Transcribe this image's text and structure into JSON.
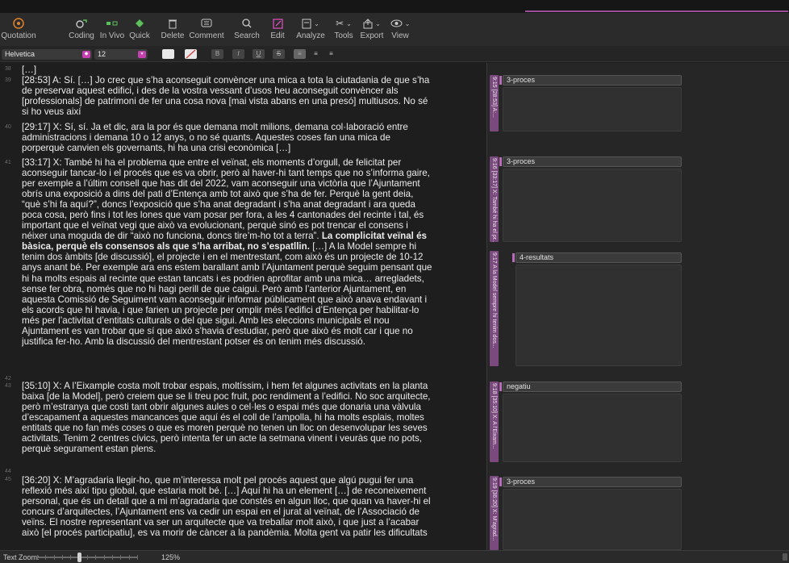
{
  "toolbar": {
    "items": [
      {
        "label": "Quotation",
        "icon": "quotation-icon"
      },
      {
        "label": "Coding",
        "icon": "coding-icon"
      },
      {
        "label": "In Vivo",
        "icon": "in-vivo-icon"
      },
      {
        "label": "Quick",
        "icon": "quick-icon"
      },
      {
        "label": "Delete",
        "icon": "trash-icon"
      },
      {
        "label": "Comment",
        "icon": "comment-icon"
      },
      {
        "label": "Search",
        "icon": "search-icon"
      },
      {
        "label": "Edit",
        "icon": "edit-icon"
      },
      {
        "label": "Analyze",
        "icon": "analyze-icon"
      },
      {
        "label": "Tools",
        "icon": "tools-icon"
      },
      {
        "label": "Export",
        "icon": "export-icon"
      },
      {
        "label": "View",
        "icon": "eye-icon"
      }
    ]
  },
  "format": {
    "font": "Helvetica",
    "size": "12",
    "bold": "B",
    "italic": "I",
    "underline": "U",
    "strike": "S"
  },
  "document": {
    "line_numbers": [
      "38",
      "39",
      "40",
      "41",
      "42",
      "43",
      "44",
      "45"
    ],
    "paragraphs": [
      {
        "lines": [
          "[…]"
        ]
      },
      {
        "lines": [
          "[28:53] A: Sí. […] Jo crec que s’ha aconseguit convèncer una mica a tota la ciutadania de que s’ha",
          "de preservar aquest edifici, i des de la vostra vessant d’usos heu aconseguit convèncer als",
          "[professionals] de patrimoni de fer una cosa nova [mai vista abans en una presó] multiusos. No sé",
          "si ho veus així"
        ]
      },
      {
        "lines": [
          "[29:17] X: Sí, sí. Ja et dic, ara la por és que demana molt milions, demana col·laboració entre",
          "administracions i demana 10 o 12 anys, o no sé quants. Aquestes coses fan una mica de",
          "porperquè canvien els governants, hi ha una crisi econòmica […]"
        ]
      },
      {
        "lines": [
          "[33:17] X: També hi ha el problema que entre el veïnat, els moments d’orgull, de felicitat per",
          "aconseguir tancar-lo i el procés que es va obrir, però al haver-hi tant temps que no s’informa gaire,",
          "per exemple a l’últim consell que has dit del 2022, vam aconseguir una victòria que l’Ajuntament",
          "obrís una exposició a dins del pati d’Entença amb tot això que s’ha de fer. Perquè la gent deia,",
          "“què s’hi fa aquí?”, doncs l’exposició que s’ha anat degradant i s’ha anat degradant i ara queda",
          "poca cosa,  però fins i tot les lones que vam posar per fora, a les 4 cantonades del recinte i tal, és",
          "important que el veïnat vegi que això va evolucionant, perquè sinó es pot trencar el consens i",
          "néixer una moguda de dir “això no funciona, doncs tire’m-ho tot a terra”. ",
          "bàsica, perquè els consensos als que s’ha arribat, no s’espatllin.",
          "tenim dos àmbits [de discussió], el projecte i en el mentrestant, com això és un projecte de 10-12",
          "anys anant bé. Per exemple ara ens estem barallant amb l’Ajuntament perquè seguim pensant que",
          "hi ha molts espais al recinte que estan tancats i es podrien aprofitar amb una mica… arregladets,",
          "sense fer obra, només que no hi hagi perill de que caigui. Però amb l’anterior Ajuntament, en",
          "aquesta Comissió de Seguiment vam aconseguir informar públicament que això anava endavant i",
          "els acords que hi havia, i que farien un projecte per omplir més l’edifici d’Entença per habilitar-lo",
          "més per l’activitat d’entitats culturals o del que sigui. Amb les eleccions municipals el nou",
          "Ajuntament es van trobar que sí que això s’havia d’estudiar, però que això és molt car i que no",
          "justifica fer-ho. Amb la discussió del mentrestant potser és on tenim més discussió."
        ]
      },
      {
        "lines": [
          "[35:10] X: A l’Eixample costa molt trobar espais, moltíssim, i hem fet algunes activitats en la planta",
          "baixa [de la Model], però creiem que se li treu poc fruit, poc rendiment a l’edifici. No soc arquitecte,",
          "però m’estranya que costi tant obrir algunes aules o cel·les o espai més que donaria una vàlvula",
          "d’escapament a aquestes mancances que aquí és el coll de l’ampolla, hi ha molts esplais, moltes",
          "entitats que no fan més coses o que es moren perquè no tenen un lloc on desenvolupar les seves",
          "activitats. Tenim 2 centres cívics, però intenta fer un acte la setmana vinent i veuràs que no pots,",
          "perquè segurament estan plens."
        ]
      },
      {
        "lines": [
          "[36:20] X: M’agradaria llegir-ho, que m’interessa molt pel procés aquest que algú pugui fer una",
          "reflexió més així tipu global, que estaria molt bé. […] Aquí hi ha un element […] de reconeixement",
          "personal, que és un detall que a mi m’agradaria que constés en algun lloc, que quan va haver-hi el",
          "concurs d’arquitectes, l’Ajuntament ens va cedir un espai en el jurat al veïnat, de l’Associació de",
          "veïns. El nostre representant va ser un arquitecte que va treballar molt això, i que just a l’acabar",
          "això [el procés participatiu], es va morir de càncer a la pandèmia. Molta gent va patir les dificultats"
        ]
      }
    ],
    "bold_inline_1": "La complicitat veïnal és",
    "bold_line_start": "bàsica, perquè els consensos als que s’ha arribat, no s’espatllin.",
    "after_bold": " […] A la Model sempre hi"
  },
  "margin": {
    "quotes": [
      {
        "tab": "9:15 [28:53] A:...",
        "code": "3-proces"
      },
      {
        "tab": "9:16 [33:17] X: També hi ha el pr...",
        "code": "3-proces"
      },
      {
        "tab": "9:17 A la Model sempre hi tenim dos...",
        "code": "4-resultats"
      },
      {
        "tab": "9:18 [35:10] X: A l’Eixam...",
        "code": "negatiu"
      },
      {
        "tab": "9:19 [36:20] X: M’agrad...",
        "code": "3-proces"
      }
    ]
  },
  "status": {
    "label": "Text Zoom:",
    "zoom": "125%",
    "zoom_level_fraction": 0.42
  }
}
